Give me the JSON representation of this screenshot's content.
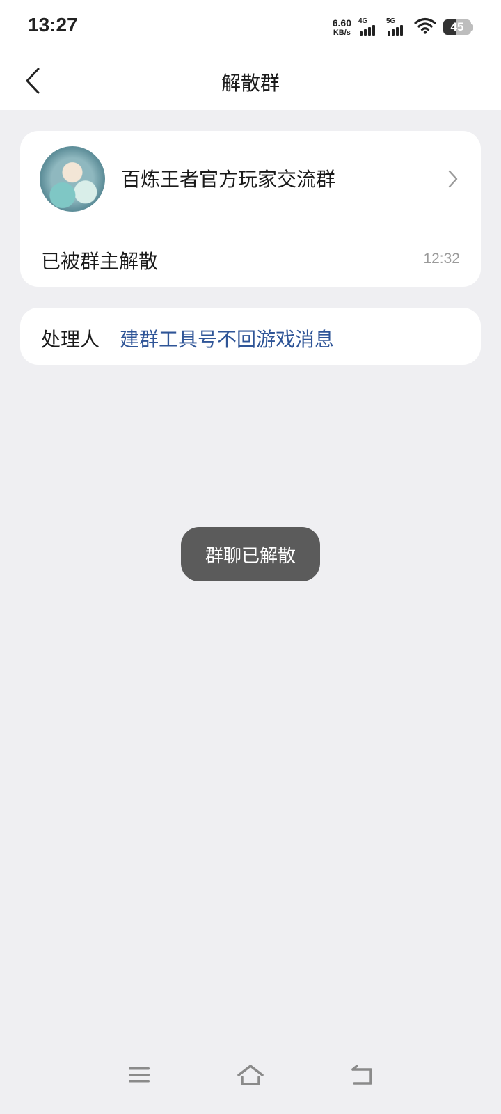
{
  "status_bar": {
    "time": "13:27",
    "net_speed_value": "6.60",
    "net_speed_unit": "KB/s",
    "sim1_label": "4G",
    "sim2_label": "5G",
    "battery_level": "45"
  },
  "header": {
    "title": "解散群"
  },
  "group_card": {
    "group_name": "百炼王者官方玩家交流群",
    "status_text": "已被群主解散",
    "time": "12:32"
  },
  "handler_card": {
    "label": "处理人",
    "value": "建群工具号不回游戏消息"
  },
  "toast": {
    "text": "群聊已解散"
  },
  "colors": {
    "background": "#efeff2",
    "card": "#ffffff",
    "link": "#2f5597",
    "toast_bg": "#5b5b5b"
  },
  "icons": {
    "back": "chevron-left-icon",
    "row_arrow": "chevron-right-icon",
    "menu": "menu-icon",
    "home": "home-icon",
    "return": "return-icon"
  }
}
